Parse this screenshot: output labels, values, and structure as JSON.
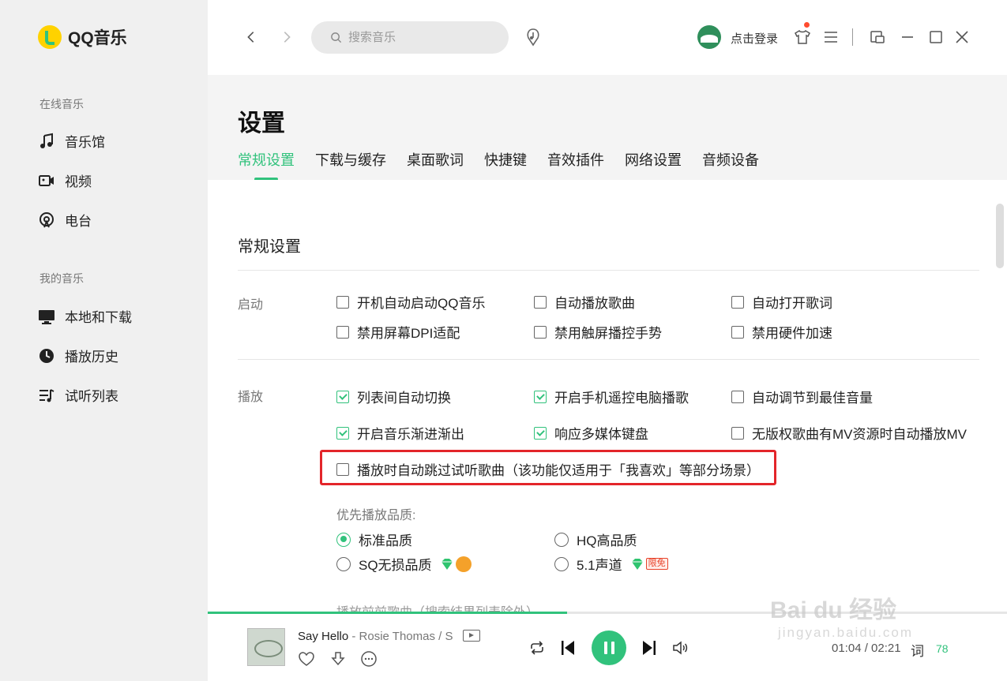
{
  "app": {
    "name": "QQ音乐"
  },
  "sidebar": {
    "online_section": "在线音乐",
    "online_items": [
      {
        "label": "音乐馆",
        "icon": "music-note-icon"
      },
      {
        "label": "视频",
        "icon": "video-camera-icon"
      },
      {
        "label": "电台",
        "icon": "radio-icon"
      }
    ],
    "my_section": "我的音乐",
    "my_items": [
      {
        "label": "本地和下载",
        "icon": "monitor-icon"
      },
      {
        "label": "播放历史",
        "icon": "history-clock-icon"
      },
      {
        "label": "试听列表",
        "icon": "playlist-icon"
      }
    ]
  },
  "topbar": {
    "search_placeholder": "搜索音乐",
    "login_label": "点击登录"
  },
  "settings": {
    "title": "设置",
    "tabs": [
      "常规设置",
      "下载与缓存",
      "桌面歌词",
      "快捷键",
      "音效插件",
      "网络设置",
      "音频设备"
    ],
    "active_tab": 0,
    "section_title": "常规设置",
    "startup": {
      "label": "启动",
      "options": [
        {
          "label": "开机自动启动QQ音乐",
          "checked": false
        },
        {
          "label": "自动播放歌曲",
          "checked": false
        },
        {
          "label": "自动打开歌词",
          "checked": false
        },
        {
          "label": "禁用屏幕DPI适配",
          "checked": false
        },
        {
          "label": "禁用触屏播控手势",
          "checked": false
        },
        {
          "label": "禁用硬件加速",
          "checked": false
        }
      ]
    },
    "playback": {
      "label": "播放",
      "options": [
        {
          "label": "列表间自动切换",
          "checked": true
        },
        {
          "label": "开启手机遥控电脑播歌",
          "checked": true
        },
        {
          "label": "自动调节到最佳音量",
          "checked": false
        },
        {
          "label": "开启音乐渐进渐出",
          "checked": true
        },
        {
          "label": "响应多媒体键盘",
          "checked": true
        },
        {
          "label": "无版权歌曲有MV资源时自动播放MV",
          "checked": false
        },
        {
          "label": "播放时自动跳过试听歌曲（该功能仅适用于「我喜欢」等部分场景）",
          "checked": false
        }
      ],
      "quality_label": "优先播放品质:",
      "quality_options": [
        {
          "label": "标准品质",
          "selected": true
        },
        {
          "label": "HQ高品质",
          "selected": false
        },
        {
          "label": "SQ无损品质",
          "selected": false
        },
        {
          "label": "5.1声道",
          "selected": false,
          "badge": "限免"
        }
      ],
      "cut_off_text": "播放前前歌曲（搜索结果列表除外）"
    }
  },
  "player": {
    "song": "Say Hello",
    "artist": "- Rosie Thomas / S",
    "time": "01:04 / 02:21",
    "lyric_label": "词",
    "count": "78",
    "progress": 0.45
  },
  "watermark": {
    "main": "Bai du 经验",
    "sub": "jingyan.baidu.com"
  },
  "colors": {
    "accent": "#31c27c",
    "highlight_border": "#e3252a"
  }
}
